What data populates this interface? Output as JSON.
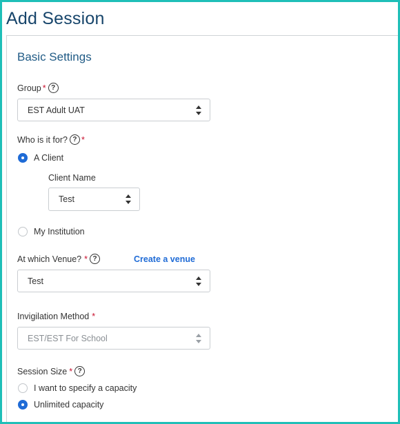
{
  "page": {
    "title": "Add Session"
  },
  "section": {
    "title": "Basic Settings"
  },
  "group": {
    "label": "Group",
    "required": "*",
    "help": "?",
    "value": "EST Adult UAT"
  },
  "who_for": {
    "label": "Who is it for?",
    "help": "?",
    "required": "*",
    "options": [
      {
        "label": "A Client",
        "selected": true
      },
      {
        "label": "My Institution",
        "selected": false
      }
    ],
    "client_name": {
      "label": "Client Name",
      "value": "Test"
    }
  },
  "venue": {
    "label": "At which Venue?",
    "required": "*",
    "help": "?",
    "create_link": "Create a venue",
    "value": "Test"
  },
  "invigilation": {
    "label": "Invigilation Method",
    "required": "*",
    "value": "EST/EST For School",
    "disabled": true
  },
  "session_size": {
    "label": "Session Size",
    "required": "*",
    "help": "?",
    "options": [
      {
        "label": "I want to specify a capacity",
        "selected": false
      },
      {
        "label": "Unlimited capacity",
        "selected": true
      }
    ]
  },
  "colors": {
    "accent": "#1f6bd6",
    "frame": "#1fbfb8",
    "title": "#17456b",
    "required": "#c8102e"
  }
}
